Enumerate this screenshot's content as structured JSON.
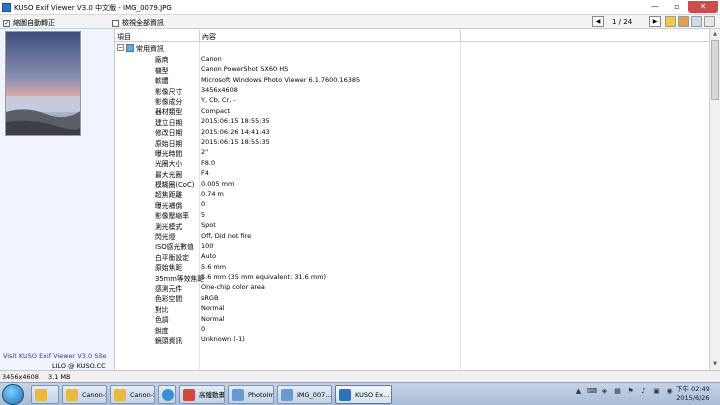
{
  "window": {
    "title": "KUSO Exif Viewer V3.0 中文版 - IMG_0079.JPG",
    "min_glyph": "—",
    "max_glyph": "▫",
    "close_glyph": "✕"
  },
  "toolbar": {
    "auto_rotate": {
      "label": "縮圖自動轉正",
      "checked": true
    },
    "show_all": {
      "label": "檢視全部資訊",
      "checked": false
    },
    "prev_glyph": "◀",
    "next_glyph": "▶",
    "page": "1 / 24"
  },
  "left_panel": {
    "visit_link": "Visit KUSO Exif Viewer V3.0 Site",
    "credit": "LILO @ KUSO.CC"
  },
  "grid": {
    "headers": {
      "item": "項目",
      "content": "內容"
    },
    "group": {
      "label": "常用資訊",
      "toggle": "−"
    },
    "rows": [
      {
        "k": "廠商",
        "v": "Canon"
      },
      {
        "k": "機型",
        "v": "Canon PowerShot SX60 HS"
      },
      {
        "k": "軟體",
        "v": "Microsoft Windows Photo Viewer 6.1.7600.16385"
      },
      {
        "k": "影像尺寸",
        "v": "3456x4608"
      },
      {
        "k": "影像成分",
        "v": "Y, Cb, Cr, -"
      },
      {
        "k": "器材類型",
        "v": "Compact"
      },
      {
        "k": "建立日期",
        "v": "2015:06:15 18:55:35"
      },
      {
        "k": "修改日期",
        "v": "2015:06:26 14:41:43"
      },
      {
        "k": "原始日期",
        "v": "2015:06:15 18:55:35"
      },
      {
        "k": "曝光時間",
        "v": "2\""
      },
      {
        "k": "光圈大小",
        "v": "F8.0"
      },
      {
        "k": "最大光圈",
        "v": "F4"
      },
      {
        "k": "模糊圈(CoC)",
        "v": "0.005 mm"
      },
      {
        "k": "超焦距離",
        "v": "0.74 m"
      },
      {
        "k": "曝光補償",
        "v": "0"
      },
      {
        "k": "影像壓縮率",
        "v": "5"
      },
      {
        "k": "測光模式",
        "v": "Spot"
      },
      {
        "k": "閃光燈",
        "v": "Off, Did not fire"
      },
      {
        "k": "ISO感光數值",
        "v": "100"
      },
      {
        "k": "白平衡設定",
        "v": "Auto"
      },
      {
        "k": "原始焦距",
        "v": "5.6 mm"
      },
      {
        "k": "35mm等效焦距",
        "v": "5.6 mm (35 mm equivalent: 31.6 mm)"
      },
      {
        "k": "感測元件",
        "v": "One-chip color area"
      },
      {
        "k": "色彩空間",
        "v": "sRGB"
      },
      {
        "k": "對比",
        "v": "Normal"
      },
      {
        "k": "色調",
        "v": "Normal"
      },
      {
        "k": "銳度",
        "v": "0"
      },
      {
        "k": "鏡頭資訊",
        "v": "Unknown (-1)"
      }
    ]
  },
  "status": {
    "dimensions": "3456x4608",
    "filesize": "3.1 MB"
  },
  "taskbar": {
    "tasks": [
      {
        "label": "",
        "icon": "folder-icon",
        "color": "#e9b83c"
      },
      {
        "label": "Canon-S...",
        "icon": "folder-icon",
        "color": "#e9b83c"
      },
      {
        "label": "Canon-S...",
        "icon": "folder-icon",
        "color": "#e9b83c"
      },
      {
        "label": "IE",
        "icon": "ie-icon",
        "color": "#3b8fd6"
      },
      {
        "label": "高鐵動畫...",
        "icon": "app-icon",
        "color": "#d04a3a"
      },
      {
        "label": "PhotoIm...",
        "icon": "photo-icon",
        "color": "#6a9ad4"
      },
      {
        "label": "IMG_007...",
        "icon": "photo-icon",
        "color": "#6a9ad4"
      },
      {
        "label": "KUSO Ex...",
        "icon": "kuso-icon",
        "color": "#2f6fbf"
      }
    ],
    "clock_time": "下午 02:49",
    "clock_date": "2015/6/26"
  },
  "colors": {
    "accent": "#2f6fbf",
    "close": "#c7504a",
    "link": "#2a3aa0"
  }
}
